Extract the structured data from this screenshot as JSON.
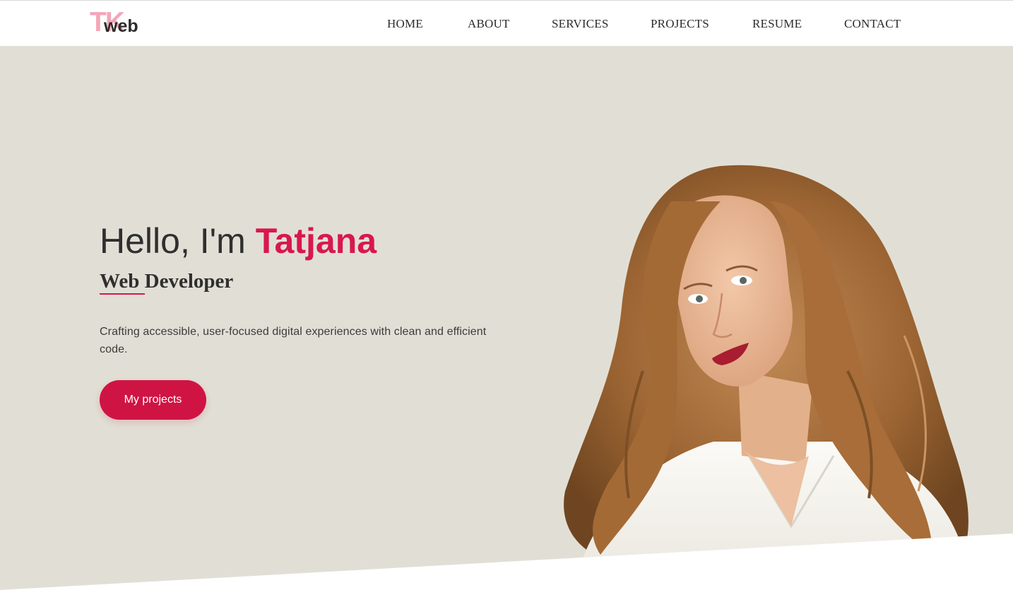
{
  "brand": {
    "logo_tk": "TK",
    "logo_web": "web"
  },
  "nav": {
    "items": [
      {
        "label": "HOME"
      },
      {
        "label": "ABOUT"
      },
      {
        "label": "SERVICES"
      },
      {
        "label": "PROJECTS"
      },
      {
        "label": "RESUME"
      },
      {
        "label": "CONTACT"
      }
    ]
  },
  "hero": {
    "greeting_prefix": "Hello, I'm ",
    "name": "Tatjana",
    "role": "Web Developer",
    "tagline": "Crafting accessible, user-focused digital experiences with clean and efficient code.",
    "cta_label": "My projects"
  },
  "colors": {
    "accent": "#d9174f",
    "hero_background": "#e1dfd5",
    "logo_pink": "#f3a6b8"
  }
}
